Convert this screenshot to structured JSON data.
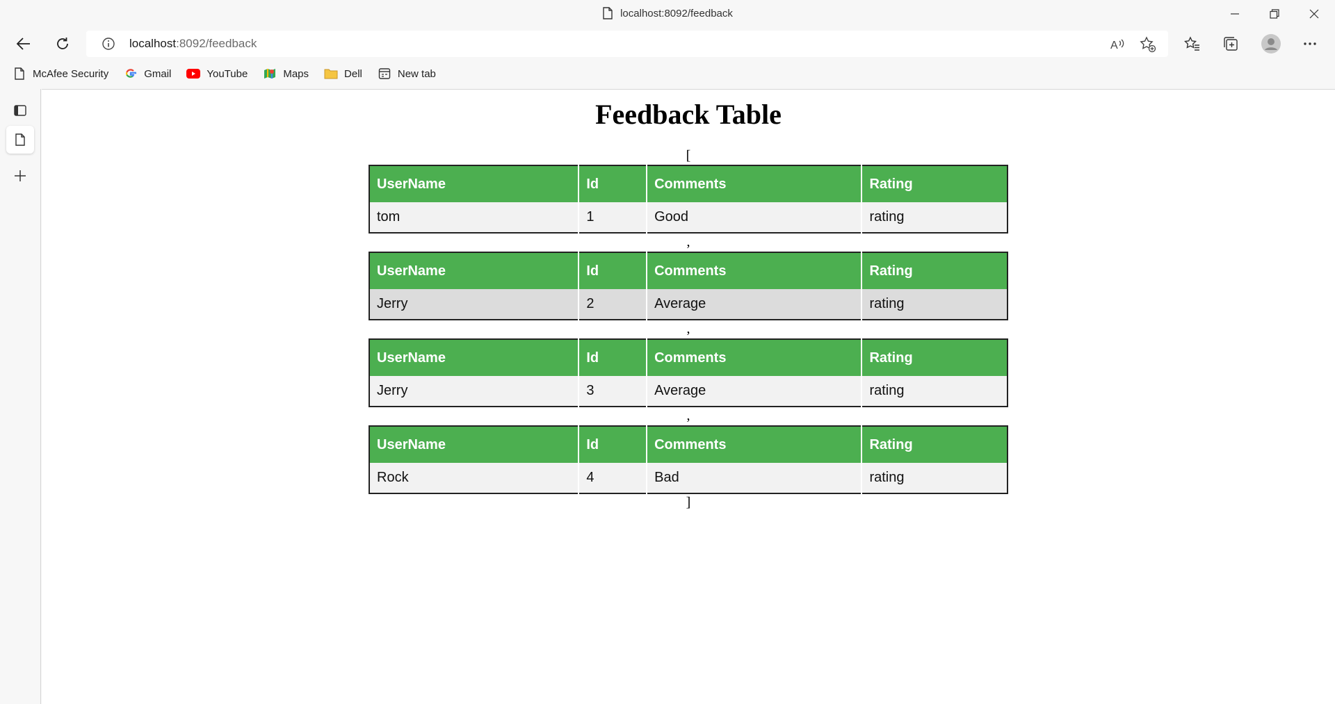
{
  "browser": {
    "window_title": "localhost:8092/feedback",
    "url_host": "localhost",
    "url_path": ":8092/feedback",
    "icons": {
      "back": "arrow-left-icon",
      "refresh": "refresh-icon",
      "info": "info-icon",
      "read_aloud": "read-aloud-icon",
      "add_favorite": "star-plus-icon",
      "favorites": "favorites-icon",
      "collections": "collections-icon",
      "profile": "avatar-icon",
      "more": "more-icon"
    }
  },
  "bookmarks": [
    {
      "label": "McAfee Security",
      "icon": "page-icon"
    },
    {
      "label": "Gmail",
      "icon": "google-icon"
    },
    {
      "label": "YouTube",
      "icon": "youtube-icon"
    },
    {
      "label": "Maps",
      "icon": "maps-icon"
    },
    {
      "label": "Dell",
      "icon": "folder-icon"
    },
    {
      "label": "New tab",
      "icon": "newtab-icon"
    }
  ],
  "page": {
    "title": "Feedback Table",
    "open_bracket": "[",
    "close_bracket": "]",
    "separator": ",",
    "headers": [
      "UserName",
      "Id",
      "Comments",
      "Rating"
    ],
    "rows": [
      {
        "username": "tom",
        "id": "1",
        "comments": "Good",
        "rating": "rating"
      },
      {
        "username": "Jerry",
        "id": "2",
        "comments": "Average",
        "rating": "rating"
      },
      {
        "username": "Jerry",
        "id": "3",
        "comments": "Average",
        "rating": "rating"
      },
      {
        "username": "Rock",
        "id": "4",
        "comments": "Bad",
        "rating": "rating"
      }
    ]
  },
  "colors": {
    "header_green": "#4caf50",
    "row_light": "#f2f2f2",
    "row_shaded": "#dcdcdc",
    "border": "#222222"
  }
}
